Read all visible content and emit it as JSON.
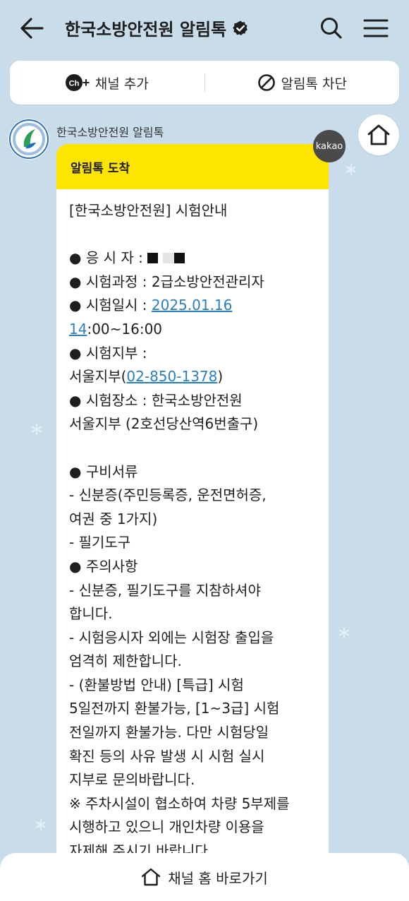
{
  "header": {
    "title": "한국소방안전원 알림톡",
    "back_icon": "back-arrow-icon",
    "verified_icon": "verified-badge-icon",
    "search_icon": "search-icon",
    "menu_icon": "menu-icon"
  },
  "actions": {
    "add_channel_badge": "Ch",
    "add_channel_plus": "+",
    "add_channel_label": "채널 추가",
    "block_label": "알림톡 차단",
    "block_icon": "block-icon"
  },
  "chat": {
    "sender_name": "한국소방안전원 알림톡",
    "kakao_badge": "kakao",
    "bubble_header": "알림톡 도착",
    "message": {
      "title": "[한국소방안전원] 시험안내",
      "bullet": "●",
      "applicant_label": "응 시 자 :",
      "course_line": "시험과정 : 2급소방안전관리자",
      "date_label": "시험일시 :",
      "date_link_part1": "2025.01.16",
      "date_link_part2": "14",
      "date_rest": ":00~16:00",
      "branch_label": "시험지부 :",
      "branch_name_prefix": "서울지부(",
      "branch_phone": "02-850-1378",
      "branch_name_suffix": ")",
      "venue_line1": "시험장소 : 한국소방안전원",
      "venue_line2": "서울지부 (2호선당산역6번출구)",
      "docs_title": "구비서류",
      "docs_line1": "- 신분증(주민등록증, 운전면허증,",
      "docs_line2": "여권 중 1가지)",
      "docs_line3": "- 필기도구",
      "notice_title": "주의사항",
      "notice_lines": [
        "- 신분증, 필기도구를 지참하셔야",
        "합니다.",
        "- 시험응시자 외에는 시험장 출입을",
        "엄격히 제한합니다.",
        "- (환불방법 안내) [특급] 시험",
        "5일전까지 환불가능, [1~3급] 시험",
        "전일까지 환불가능. 다만 시험당일",
        "확진 등의 사유 발생 시 시험 실시",
        "지부로 문의바랍니다.",
        "※ 주차시설이 협소하여 차량 5부제를",
        "시행하고 있으니 개인차량 이용을",
        "자제해 주시기 바랍니다."
      ]
    }
  },
  "bottom": {
    "label": "채널 홈 바로가기",
    "icon": "home-icon"
  },
  "colors": {
    "background": "#c9dcea",
    "bubble_header": "#fee500",
    "link": "#2a7fbf",
    "kakao_badge": "#4a4a4a"
  }
}
